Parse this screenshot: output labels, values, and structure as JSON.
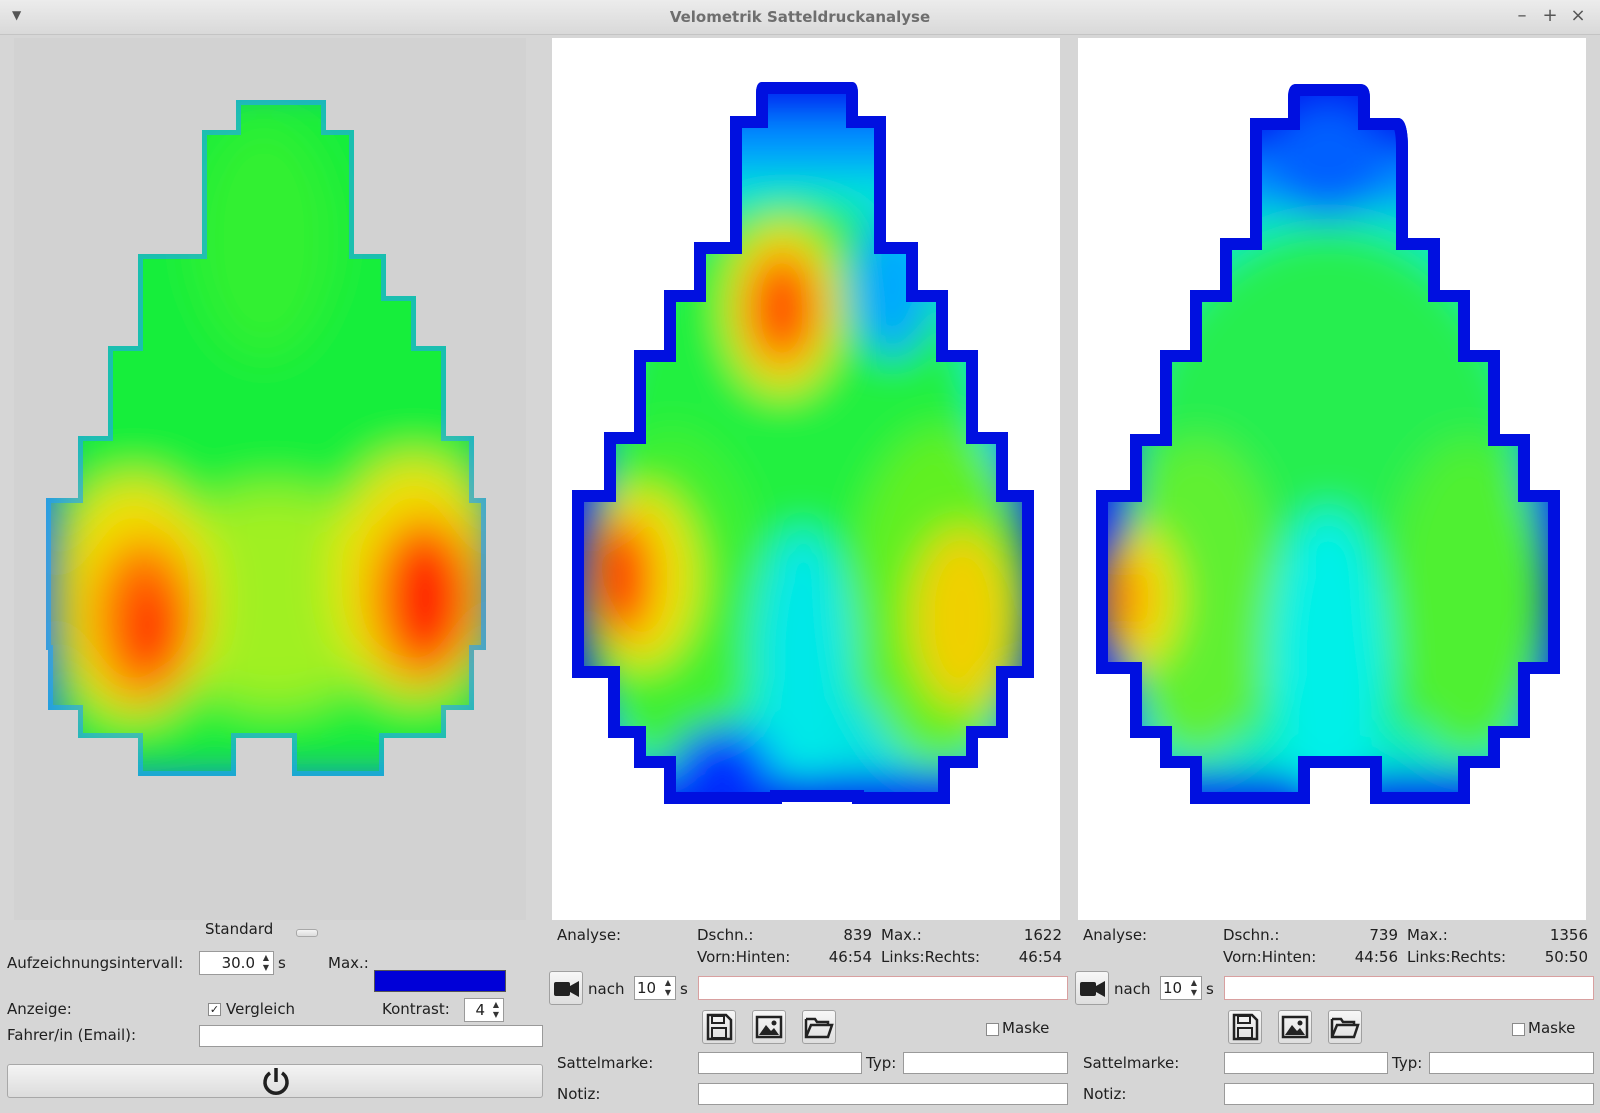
{
  "window": {
    "title": "Velometrik Satteldruckanalyse"
  },
  "colors": {
    "max_swatch": "#0000d8"
  },
  "left_panel": {
    "mode_label": "Standard",
    "interval_label": "Aufzeichnungsintervall:",
    "interval_value": "30.0",
    "interval_unit": "s",
    "max_label": "Max.:",
    "display_label": "Anzeige:",
    "compare_label": "Vergleich",
    "compare_checked": true,
    "contrast_label": "Kontrast:",
    "contrast_value": "4",
    "rider_label": "Fahrer/in (Email):",
    "rider_value": "",
    "power_icon": "power-icon"
  },
  "panels": [
    {
      "analysis_label": "Analyse:",
      "avg_label": "Dschn.:",
      "avg_value": "839",
      "max_label": "Max.:",
      "max_value": "1622",
      "fb_label": "Vorn:Hinten:",
      "fb_value": "46:54",
      "lr_label": "Links:Rechts:",
      "lr_value": "46:54",
      "after_label": "nach",
      "after_value": "10",
      "after_unit": "s",
      "mask_label": "Maske",
      "brand_label": "Sattelmarke:",
      "type_label": "Typ:",
      "note_label": "Notiz:"
    },
    {
      "analysis_label": "Analyse:",
      "avg_label": "Dschn.:",
      "avg_value": "739",
      "max_label": "Max.:",
      "max_value": "1356",
      "fb_label": "Vorn:Hinten:",
      "fb_value": "44:56",
      "lr_label": "Links:Rechts:",
      "lr_value": "50:50",
      "after_label": "nach",
      "after_value": "10",
      "after_unit": "s",
      "mask_label": "Maske",
      "brand_label": "Sattelmarke:",
      "type_label": "Typ:",
      "note_label": "Notiz:"
    }
  ]
}
